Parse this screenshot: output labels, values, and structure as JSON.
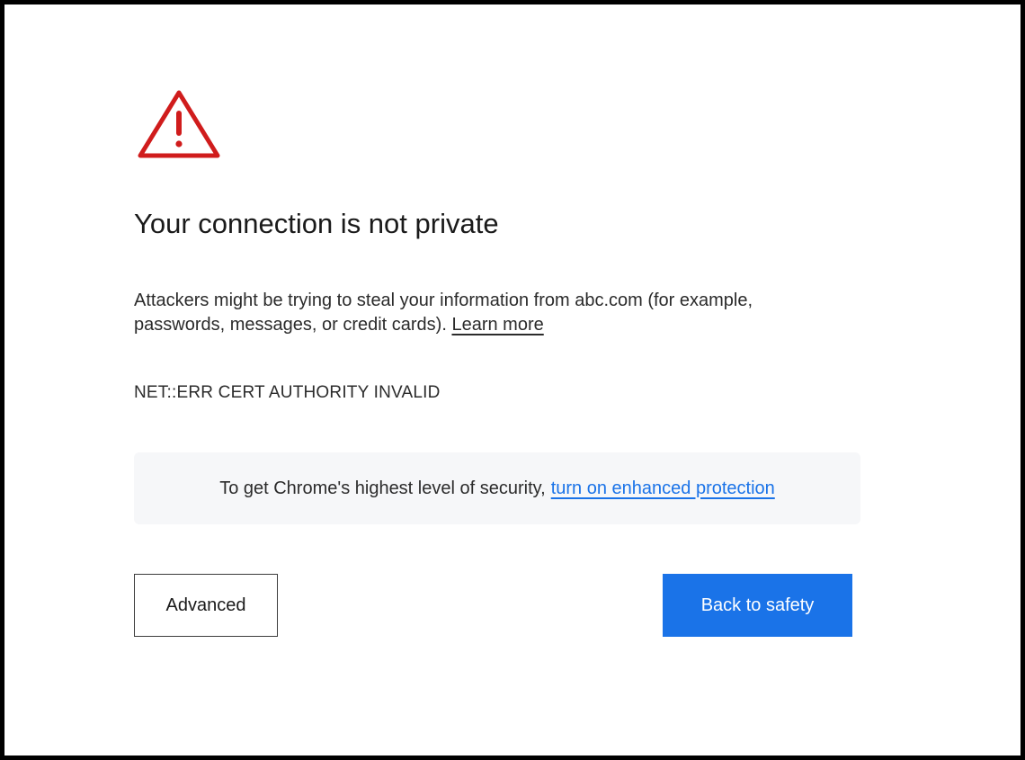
{
  "warning": {
    "icon": "warning-triangle-icon",
    "color": "#d01c1c"
  },
  "page": {
    "title": "Your connection is not private",
    "description": "Attackers might be trying to steal your information from abc.com (for example, passwords, messages, or credit cards).",
    "learn_more": "Learn more",
    "error_code": "NET::ERR CERT AUTHORITY INVALID"
  },
  "protection": {
    "text": "To get Chrome's highest level of security,",
    "link": "turn on enhanced protection",
    "link_color": "#1a73e8"
  },
  "buttons": {
    "advanced": "Advanced",
    "back_to_safety": "Back to safety",
    "primary_color": "#1a73e8"
  }
}
